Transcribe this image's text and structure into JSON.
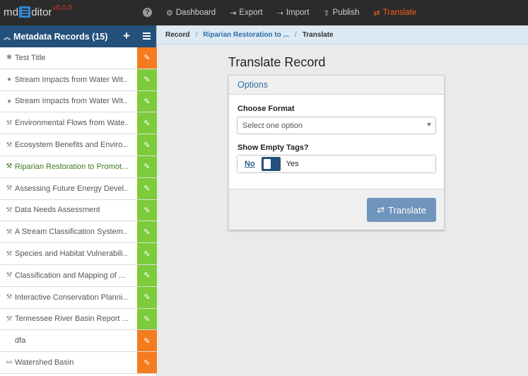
{
  "brand": {
    "part1": "md",
    "part2": "ditor",
    "version": "v0.0.0"
  },
  "nav": [
    {
      "label": "Dashboard",
      "icon": "dashboard-icon",
      "glyph": "⚙"
    },
    {
      "label": "Export",
      "icon": "export-icon",
      "glyph": "⇥"
    },
    {
      "label": "Import",
      "icon": "import-icon",
      "glyph": "⇢"
    },
    {
      "label": "Publish",
      "icon": "publish-icon",
      "glyph": "⇪"
    },
    {
      "label": "Translate",
      "icon": "translate-icon",
      "glyph": "⇄",
      "active": true
    }
  ],
  "sidebar": {
    "title": "Metadata Records (15)",
    "records": [
      {
        "label": "Test Title",
        "icon": "android-icon",
        "glyph": "✱",
        "edit": "orange"
      },
      {
        "label": "Stream Impacts from Water Wit...",
        "icon": "globe-icon",
        "glyph": "●",
        "edit": "green"
      },
      {
        "label": "Stream Impacts from Water Wit...",
        "icon": "globe-icon",
        "glyph": "●",
        "edit": "green"
      },
      {
        "label": "Environmental Flows from Wate...",
        "icon": "wrench-icon",
        "glyph": "⚒",
        "edit": "green"
      },
      {
        "label": "Ecosystem Benefits and Enviro...",
        "icon": "wrench-icon",
        "glyph": "⚒",
        "edit": "green"
      },
      {
        "label": "Riparian Restoration to Promot...",
        "icon": "wrench-icon",
        "glyph": "⚒",
        "edit": "green",
        "active": true
      },
      {
        "label": "Assessing Future Energy Devel...",
        "icon": "wrench-icon",
        "glyph": "⚒",
        "edit": "green"
      },
      {
        "label": "Data Needs Assessment",
        "icon": "wrench-icon",
        "glyph": "⚒",
        "edit": "green"
      },
      {
        "label": "A Stream Classification System...",
        "icon": "wrench-icon",
        "glyph": "⚒",
        "edit": "green"
      },
      {
        "label": "Species and Habitat Vulnerabili...",
        "icon": "wrench-icon",
        "glyph": "⚒",
        "edit": "green"
      },
      {
        "label": "Classification and Mapping of ...",
        "icon": "wrench-icon",
        "glyph": "⚒",
        "edit": "green"
      },
      {
        "label": "Interactive Conservation Planni...",
        "icon": "wrench-icon",
        "glyph": "⚒",
        "edit": "green"
      },
      {
        "label": "Tennessee River Basin Report ...",
        "icon": "wrench-icon",
        "glyph": "⚒",
        "edit": "green"
      },
      {
        "label": "dfa",
        "icon": "",
        "glyph": "",
        "edit": "orange"
      },
      {
        "label": "Watershed Basin",
        "icon": "sitemap-icon",
        "glyph": "⚯",
        "edit": "orange"
      }
    ]
  },
  "breadcrumb": {
    "root": "Record",
    "middle": "Riparian Restoration to ...",
    "current": "Translate"
  },
  "main": {
    "title": "Translate Record",
    "panel_title": "Options",
    "format_label": "Choose Format",
    "format_placeholder": "Select one option",
    "empty_tags_label": "Show Empty Tags?",
    "toggle_no": "No",
    "toggle_yes": "Yes",
    "button_label": "Translate"
  },
  "colors": {
    "accent_orange": "#ff5a1f",
    "sidebar_header": "#24507c",
    "edit_green": "#7ccb3a",
    "edit_orange": "#f47c1f"
  }
}
